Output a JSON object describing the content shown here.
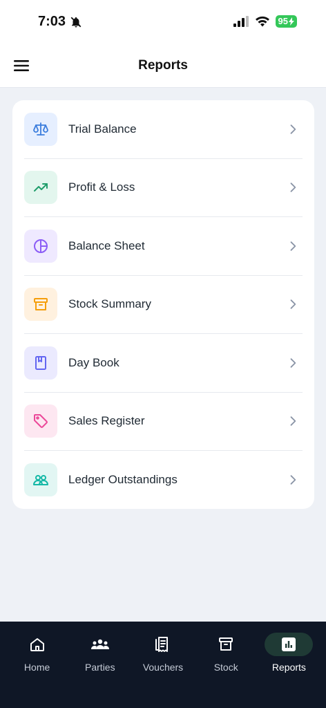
{
  "status_bar": {
    "time": "7:03",
    "battery": "95"
  },
  "header": {
    "title": "Reports"
  },
  "reports": [
    {
      "label": "Trial Balance",
      "icon": "scale-icon",
      "color": "#3b7ddd",
      "bg": "#e6efff"
    },
    {
      "label": "Profit & Loss",
      "icon": "trending-up-icon",
      "color": "#1f9d6b",
      "bg": "#e3f6ee"
    },
    {
      "label": "Balance Sheet",
      "icon": "pie-chart-icon",
      "color": "#8b5cf6",
      "bg": "#efe9ff"
    },
    {
      "label": "Stock Summary",
      "icon": "archive-box-icon",
      "color": "#f59e0b",
      "bg": "#fff1df"
    },
    {
      "label": "Day Book",
      "icon": "book-icon",
      "color": "#6366f1",
      "bg": "#ebeafe"
    },
    {
      "label": "Sales Register",
      "icon": "tag-icon",
      "color": "#ec4899",
      "bg": "#fde7f1"
    },
    {
      "label": "Ledger Outstandings",
      "icon": "users-icon",
      "color": "#14b8a6",
      "bg": "#e2f6f3"
    }
  ],
  "nav": {
    "items": [
      {
        "label": "Home",
        "icon": "home-icon"
      },
      {
        "label": "Parties",
        "icon": "parties-icon"
      },
      {
        "label": "Vouchers",
        "icon": "receipt-icon"
      },
      {
        "label": "Stock",
        "icon": "archive-icon"
      },
      {
        "label": "Reports",
        "icon": "bar-chart-icon",
        "active": true
      }
    ],
    "active_color": "#1f3a35"
  }
}
